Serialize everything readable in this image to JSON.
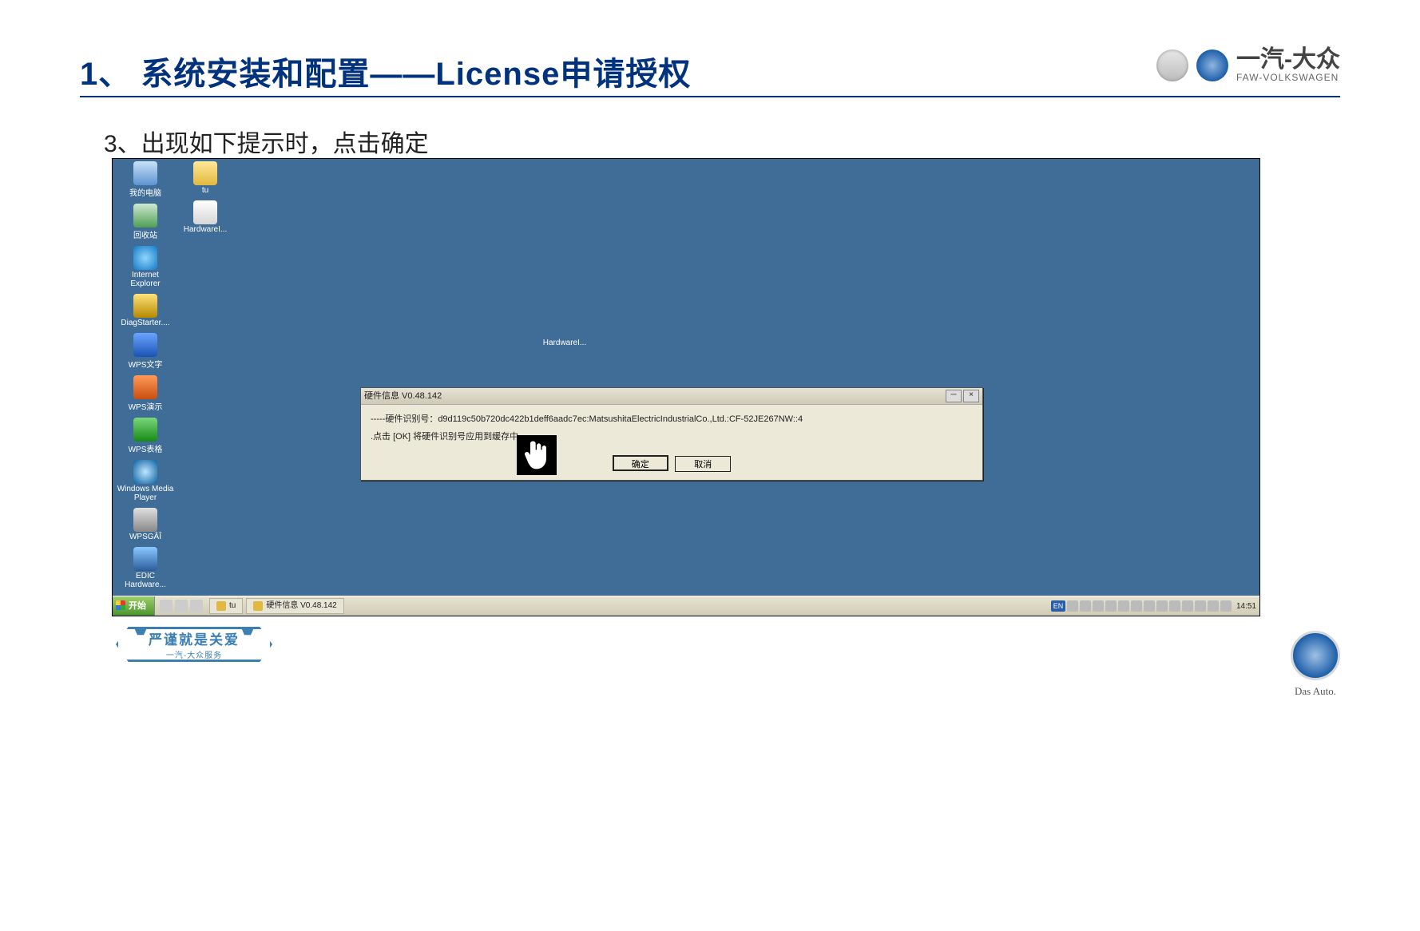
{
  "header": {
    "title": "1、 系统安装和配置——License申请授权",
    "brand_cn": "一汽-大众",
    "brand_en": "FAW-VOLKSWAGEN"
  },
  "subtitle": "3、出现如下提示时，点击确定",
  "desktop": {
    "col1": [
      {
        "name": "mycomputer",
        "label": "我的电脑",
        "icon": "ic-mycomp"
      },
      {
        "name": "recycle",
        "label": "回收站",
        "icon": "ic-recycle"
      },
      {
        "name": "ie",
        "label": "Internet Explorer",
        "icon": "ic-ie"
      },
      {
        "name": "diag",
        "label": "DiagStarter....",
        "icon": "ic-diag"
      },
      {
        "name": "wpsw",
        "label": "WPS文字",
        "icon": "ic-wps-w"
      },
      {
        "name": "wpsp",
        "label": "WPS演示",
        "icon": "ic-wps-p"
      },
      {
        "name": "wpss",
        "label": "WPS表格",
        "icon": "ic-wps-s"
      },
      {
        "name": "wmp",
        "label": "Windows Media Player",
        "icon": "ic-wmp"
      },
      {
        "name": "wpsg",
        "label": "WPSGÂÎ",
        "icon": "ic-wpsg"
      },
      {
        "name": "edic",
        "label": "EDIC Hardware...",
        "icon": "ic-edic"
      }
    ],
    "col2": [
      {
        "name": "tu",
        "label": "tu",
        "icon": "ic-folder"
      },
      {
        "name": "hw",
        "label": "HardwareI...",
        "icon": "ic-hw"
      }
    ],
    "center": {
      "name": "hwi-center",
      "label": "HardwareI..."
    }
  },
  "dialog": {
    "title": "硬件信息 V0.48.142",
    "line1": "-----硬件识别号：d9d119c50b720dc422b1deff6aadc7ec:MatsushitaElectricIndustrialCo.,Ltd.:CF-52JE267NW::4",
    "line2": ".点击 [OK] 将硬件识别号应用到缓存中。",
    "ok": "确定",
    "cancel": "取消"
  },
  "taskbar": {
    "start": "开始",
    "tasks": [
      {
        "label": "tu"
      },
      {
        "label": "硬件信息 V0.48.142"
      }
    ],
    "lang": "EN",
    "clock": "14:51"
  },
  "footer": {
    "motto_big": "严谨就是关爱",
    "motto_small": "一汽-大众服务",
    "dasauto": "Das Auto."
  }
}
